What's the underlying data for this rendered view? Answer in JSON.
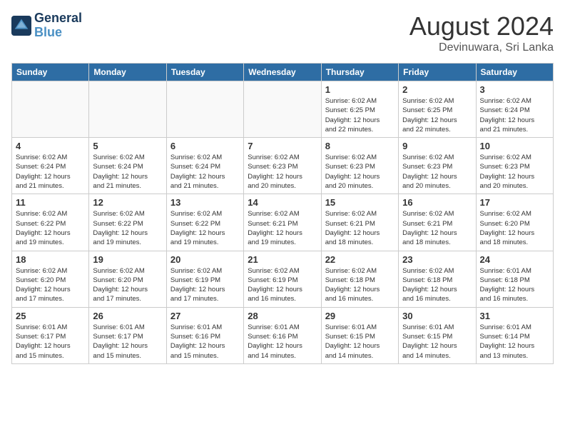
{
  "header": {
    "logo_line1": "General",
    "logo_line2": "Blue",
    "month_year": "August 2024",
    "location": "Devinuwara, Sri Lanka"
  },
  "weekdays": [
    "Sunday",
    "Monday",
    "Tuesday",
    "Wednesday",
    "Thursday",
    "Friday",
    "Saturday"
  ],
  "weeks": [
    [
      {
        "day": "",
        "info": ""
      },
      {
        "day": "",
        "info": ""
      },
      {
        "day": "",
        "info": ""
      },
      {
        "day": "",
        "info": ""
      },
      {
        "day": "1",
        "info": "Sunrise: 6:02 AM\nSunset: 6:25 PM\nDaylight: 12 hours\nand 22 minutes."
      },
      {
        "day": "2",
        "info": "Sunrise: 6:02 AM\nSunset: 6:25 PM\nDaylight: 12 hours\nand 22 minutes."
      },
      {
        "day": "3",
        "info": "Sunrise: 6:02 AM\nSunset: 6:24 PM\nDaylight: 12 hours\nand 21 minutes."
      }
    ],
    [
      {
        "day": "4",
        "info": "Sunrise: 6:02 AM\nSunset: 6:24 PM\nDaylight: 12 hours\nand 21 minutes."
      },
      {
        "day": "5",
        "info": "Sunrise: 6:02 AM\nSunset: 6:24 PM\nDaylight: 12 hours\nand 21 minutes."
      },
      {
        "day": "6",
        "info": "Sunrise: 6:02 AM\nSunset: 6:24 PM\nDaylight: 12 hours\nand 21 minutes."
      },
      {
        "day": "7",
        "info": "Sunrise: 6:02 AM\nSunset: 6:23 PM\nDaylight: 12 hours\nand 20 minutes."
      },
      {
        "day": "8",
        "info": "Sunrise: 6:02 AM\nSunset: 6:23 PM\nDaylight: 12 hours\nand 20 minutes."
      },
      {
        "day": "9",
        "info": "Sunrise: 6:02 AM\nSunset: 6:23 PM\nDaylight: 12 hours\nand 20 minutes."
      },
      {
        "day": "10",
        "info": "Sunrise: 6:02 AM\nSunset: 6:23 PM\nDaylight: 12 hours\nand 20 minutes."
      }
    ],
    [
      {
        "day": "11",
        "info": "Sunrise: 6:02 AM\nSunset: 6:22 PM\nDaylight: 12 hours\nand 19 minutes."
      },
      {
        "day": "12",
        "info": "Sunrise: 6:02 AM\nSunset: 6:22 PM\nDaylight: 12 hours\nand 19 minutes."
      },
      {
        "day": "13",
        "info": "Sunrise: 6:02 AM\nSunset: 6:22 PM\nDaylight: 12 hours\nand 19 minutes."
      },
      {
        "day": "14",
        "info": "Sunrise: 6:02 AM\nSunset: 6:21 PM\nDaylight: 12 hours\nand 19 minutes."
      },
      {
        "day": "15",
        "info": "Sunrise: 6:02 AM\nSunset: 6:21 PM\nDaylight: 12 hours\nand 18 minutes."
      },
      {
        "day": "16",
        "info": "Sunrise: 6:02 AM\nSunset: 6:21 PM\nDaylight: 12 hours\nand 18 minutes."
      },
      {
        "day": "17",
        "info": "Sunrise: 6:02 AM\nSunset: 6:20 PM\nDaylight: 12 hours\nand 18 minutes."
      }
    ],
    [
      {
        "day": "18",
        "info": "Sunrise: 6:02 AM\nSunset: 6:20 PM\nDaylight: 12 hours\nand 17 minutes."
      },
      {
        "day": "19",
        "info": "Sunrise: 6:02 AM\nSunset: 6:20 PM\nDaylight: 12 hours\nand 17 minutes."
      },
      {
        "day": "20",
        "info": "Sunrise: 6:02 AM\nSunset: 6:19 PM\nDaylight: 12 hours\nand 17 minutes."
      },
      {
        "day": "21",
        "info": "Sunrise: 6:02 AM\nSunset: 6:19 PM\nDaylight: 12 hours\nand 16 minutes."
      },
      {
        "day": "22",
        "info": "Sunrise: 6:02 AM\nSunset: 6:18 PM\nDaylight: 12 hours\nand 16 minutes."
      },
      {
        "day": "23",
        "info": "Sunrise: 6:02 AM\nSunset: 6:18 PM\nDaylight: 12 hours\nand 16 minutes."
      },
      {
        "day": "24",
        "info": "Sunrise: 6:01 AM\nSunset: 6:18 PM\nDaylight: 12 hours\nand 16 minutes."
      }
    ],
    [
      {
        "day": "25",
        "info": "Sunrise: 6:01 AM\nSunset: 6:17 PM\nDaylight: 12 hours\nand 15 minutes."
      },
      {
        "day": "26",
        "info": "Sunrise: 6:01 AM\nSunset: 6:17 PM\nDaylight: 12 hours\nand 15 minutes."
      },
      {
        "day": "27",
        "info": "Sunrise: 6:01 AM\nSunset: 6:16 PM\nDaylight: 12 hours\nand 15 minutes."
      },
      {
        "day": "28",
        "info": "Sunrise: 6:01 AM\nSunset: 6:16 PM\nDaylight: 12 hours\nand 14 minutes."
      },
      {
        "day": "29",
        "info": "Sunrise: 6:01 AM\nSunset: 6:15 PM\nDaylight: 12 hours\nand 14 minutes."
      },
      {
        "day": "30",
        "info": "Sunrise: 6:01 AM\nSunset: 6:15 PM\nDaylight: 12 hours\nand 14 minutes."
      },
      {
        "day": "31",
        "info": "Sunrise: 6:01 AM\nSunset: 6:14 PM\nDaylight: 12 hours\nand 13 minutes."
      }
    ]
  ]
}
